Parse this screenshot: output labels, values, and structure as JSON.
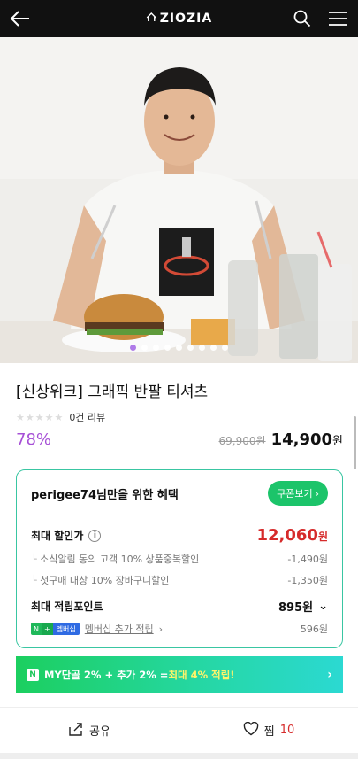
{
  "header": {
    "brand": "ZIOZIA",
    "icons": [
      "back-arrow-icon",
      "home-icon",
      "search-icon",
      "menu-icon"
    ]
  },
  "hero": {
    "carousel_dots": 9,
    "active_dot": 1
  },
  "product": {
    "title": "[신상위크] 그래픽 반팔 티셔츠",
    "review_count": "0건 리뷰",
    "discount_rate": "78%",
    "original_price": "69,900원",
    "final_price": "14,900",
    "currency": "원"
  },
  "benefit": {
    "title": "perigee74님만을 위한 혜택",
    "coupon_button": "쿠폰보기",
    "max_discount_label": "최대 할인가",
    "max_discount_value": "12,060",
    "currency": "원",
    "discount_items": [
      {
        "label": "소식알림 동의 고객 10% 상품중복할인",
        "value": "-1,490원"
      },
      {
        "label": "첫구매 대상 10% 장바구니할인",
        "value": "-1,350원"
      }
    ],
    "max_points_label": "최대 적립포인트",
    "max_points_value": "895원",
    "membership_badge": "멤버십",
    "membership_link": "멤버십 추가 적립",
    "membership_points": "596원"
  },
  "banner": {
    "icon_letter": "N",
    "text_part1": "MY단골 2% + 추가 2% = ",
    "text_highlight": "최대 4% 적립!"
  },
  "bottom": {
    "share_label": "공유",
    "wish_label": "찜",
    "wish_count": "10"
  },
  "colors": {
    "accent_purple": "#a64fd6",
    "price_red": "#d62b2b",
    "naver_green": "#1cc46a",
    "border_teal": "#39c6a2"
  }
}
